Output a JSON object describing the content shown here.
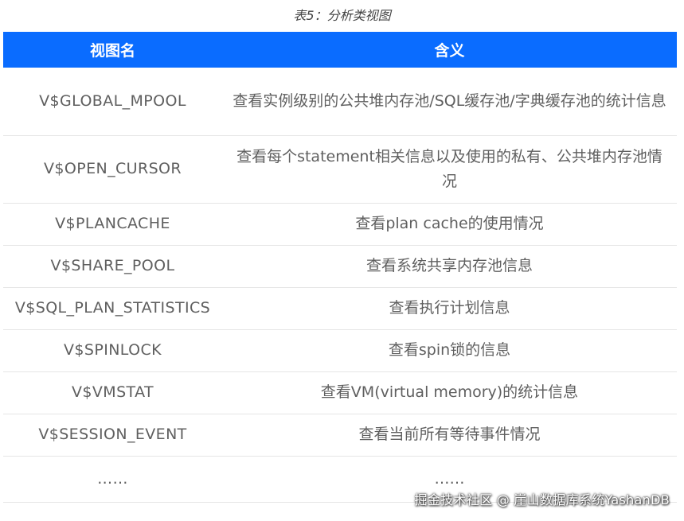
{
  "caption": "表5：分析类视图",
  "table": {
    "headers": [
      "视图名",
      "含义"
    ],
    "rows": [
      {
        "name": "V$GLOBAL_MPOOL",
        "desc": "查看实例级别的公共堆内存池/SQL缓存池/字典缓存池的统计信息"
      },
      {
        "name": "V$OPEN_CURSOR",
        "desc": "查看每个statement相关信息以及使用的私有、公共堆内存池情况"
      },
      {
        "name": "V$PLANCACHE",
        "desc": "查看plan cache的使用情况"
      },
      {
        "name": "V$SHARE_POOL",
        "desc": "查看系统共享内存池信息"
      },
      {
        "name": "V$SQL_PLAN_STATISTICS",
        "desc": "查看执行计划信息"
      },
      {
        "name": "V$SPINLOCK",
        "desc": "查看spin锁的信息"
      },
      {
        "name": "V$VMSTAT",
        "desc": "查看VM(virtual memory)的统计信息"
      },
      {
        "name": "V$SESSION_EVENT",
        "desc": "查看当前所有等待事件情况"
      },
      {
        "name": "……",
        "desc": "……"
      }
    ]
  },
  "watermark": "掘金技术社区 @ 崖山数据库系统YashanDB",
  "colors": {
    "header_bg": "#0a6cff",
    "header_text": "#ffffff",
    "cell_text": "#5f5f5f",
    "row_border": "#e6e6e6"
  }
}
